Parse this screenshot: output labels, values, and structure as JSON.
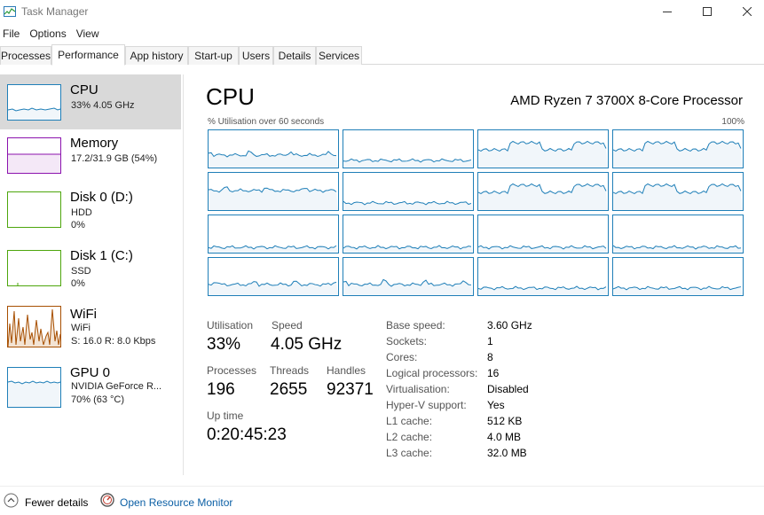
{
  "window": {
    "title": "Task Manager"
  },
  "menu": [
    "File",
    "Options",
    "View"
  ],
  "tabs": [
    "Processes",
    "Performance",
    "App history",
    "Start-up",
    "Users",
    "Details",
    "Services"
  ],
  "sidebar": {
    "items": [
      {
        "name": "CPU",
        "line1": "33% 4.05 GHz",
        "line2": ""
      },
      {
        "name": "Memory",
        "line1": "17.2/31.9 GB (54%)",
        "line2": ""
      },
      {
        "name": "Disk 0 (D:)",
        "line1": "HDD",
        "line2": "0%"
      },
      {
        "name": "Disk 1 (C:)",
        "line1": "SSD",
        "line2": "0%"
      },
      {
        "name": "WiFi",
        "line1": "WiFi",
        "line2": "S: 16.0 R: 8.0 Kbps"
      },
      {
        "name": "GPU 0",
        "line1": "NVIDIA GeForce R...",
        "line2": "70% (63 °C)"
      }
    ]
  },
  "main": {
    "title": "CPU",
    "processor": "AMD Ryzen 7 3700X 8-Core Processor",
    "graph_caption": "% Utilisation over 60 seconds",
    "graph_max": "100%",
    "stats": {
      "utilisation_label": "Utilisation",
      "utilisation": "33%",
      "speed_label": "Speed",
      "speed": "4.05 GHz",
      "processes_label": "Processes",
      "processes": "196",
      "threads_label": "Threads",
      "threads": "2655",
      "handles_label": "Handles",
      "handles": "92371",
      "uptime_label": "Up time",
      "uptime": "0:20:45:23"
    },
    "details": [
      {
        "label": "Base speed:",
        "value": "3.60 GHz"
      },
      {
        "label": "Sockets:",
        "value": "1"
      },
      {
        "label": "Cores:",
        "value": "8"
      },
      {
        "label": "Logical processors:",
        "value": "16"
      },
      {
        "label": "Virtualisation:",
        "value": "Disabled"
      },
      {
        "label": "Hyper-V support:",
        "value": "Yes"
      },
      {
        "label": "L1 cache:",
        "value": "512 KB"
      },
      {
        "label": "L2 cache:",
        "value": "4.0 MB"
      },
      {
        "label": "L3 cache:",
        "value": "32.0 MB"
      }
    ]
  },
  "footer": {
    "fewer_details": "Fewer details",
    "resource_monitor": "Open Resource Monitor"
  },
  "colors": {
    "cpu_line": "#1f7fb8",
    "cpu_fill": "#f1f6fa",
    "memory": "#8b12ae",
    "disk": "#4da60c",
    "wifi": "#a74f01",
    "gpu": "#1f7fb8"
  }
}
